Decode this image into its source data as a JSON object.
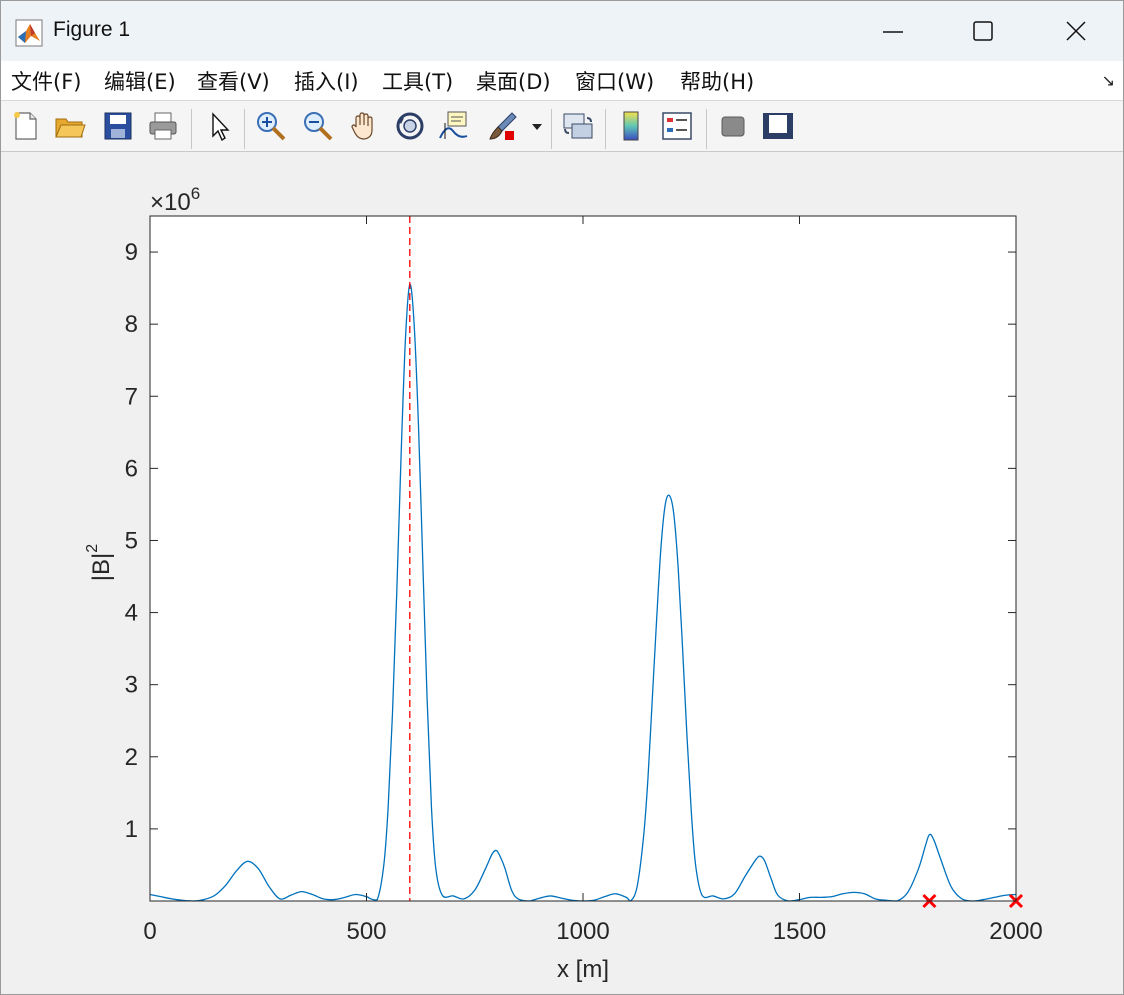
{
  "window": {
    "title": "Figure 1",
    "icon": "matlab-logo-icon",
    "controls": [
      "minimize-icon",
      "maximize-icon",
      "close-icon"
    ]
  },
  "menu": [
    "文件(F)",
    "编辑(E)",
    "查看(V)",
    "插入(I)",
    "工具(T)",
    "桌面(D)",
    "窗口(W)",
    "帮助(H)"
  ],
  "menu_expand_glyph": "↘",
  "toolbar": [
    "new-figure-icon",
    "open-file-icon",
    "save-icon",
    "print-icon",
    "edit-plot-arrow-icon",
    "zoom-in-icon",
    "zoom-out-icon",
    "pan-hand-icon",
    "rotate-3d-icon",
    "data-tips-icon",
    "brush-icon",
    "brush-dropdown-icon",
    "link-plot-icon",
    "colorbar-icon",
    "legend-icon",
    "hide-plot-tools-icon",
    "show-plot-tools-icon"
  ],
  "colors": {
    "line": "#0072BD",
    "marker": "#ff0000",
    "dashed_line": "#ff0000",
    "axes_bg": "#ffffff",
    "figure_bg": "#f0f0f0"
  },
  "chart_data": {
    "type": "line",
    "xlabel": "x [m]",
    "ylabel": "|B|",
    "ylabel_superscript": "2",
    "exponent_label": "×10",
    "exponent_power": "6",
    "xlim": [
      0,
      2000
    ],
    "ylim": [
      0,
      9.5
    ],
    "y_scale": 1000000,
    "xticks": [
      0,
      500,
      1000,
      1500,
      2000
    ],
    "yticks": [
      1,
      2,
      3,
      4,
      5,
      6,
      7,
      8,
      9
    ],
    "grid": false,
    "series": [
      {
        "x": [
          0,
          25,
          50,
          75,
          100,
          125,
          150,
          175,
          200,
          225,
          250,
          275,
          300,
          325,
          350,
          375,
          400,
          425,
          450,
          475,
          500,
          510,
          525,
          540,
          550,
          560,
          570,
          580,
          590,
          600,
          610,
          620,
          630,
          640,
          650,
          660,
          675,
          700,
          725,
          750,
          775,
          790,
          800,
          810,
          820,
          835,
          850,
          875,
          900,
          925,
          950,
          975,
          1000,
          1025,
          1050,
          1075,
          1100,
          1110,
          1125,
          1140,
          1150,
          1160,
          1170,
          1180,
          1190,
          1200,
          1210,
          1220,
          1230,
          1240,
          1250,
          1260,
          1275,
          1300,
          1325,
          1350,
          1375,
          1400,
          1410,
          1420,
          1435,
          1450,
          1475,
          1500,
          1525,
          1550,
          1575,
          1600,
          1625,
          1650,
          1675,
          1700,
          1725,
          1750,
          1775,
          1790,
          1800,
          1810,
          1825,
          1850,
          1875,
          1900,
          1925,
          1950,
          1975,
          2000
        ],
        "y": [
          0.09,
          0.06,
          0.03,
          0.01,
          0.0,
          0.02,
          0.08,
          0.22,
          0.42,
          0.55,
          0.45,
          0.2,
          0.03,
          0.08,
          0.13,
          0.09,
          0.03,
          0.02,
          0.05,
          0.09,
          0.06,
          0.03,
          0.02,
          0.5,
          1.3,
          2.6,
          4.3,
          6.2,
          7.8,
          8.55,
          8.0,
          6.6,
          4.7,
          2.8,
          1.3,
          0.45,
          0.08,
          0.07,
          0.03,
          0.15,
          0.45,
          0.65,
          0.7,
          0.6,
          0.45,
          0.15,
          0.03,
          0.0,
          0.04,
          0.07,
          0.04,
          0.01,
          0.0,
          0.01,
          0.06,
          0.1,
          0.05,
          0.0,
          0.2,
          0.9,
          1.7,
          2.8,
          3.9,
          4.9,
          5.5,
          5.62,
          5.35,
          4.6,
          3.5,
          2.3,
          1.25,
          0.5,
          0.08,
          0.07,
          0.03,
          0.1,
          0.35,
          0.58,
          0.62,
          0.55,
          0.3,
          0.08,
          0.0,
          0.02,
          0.05,
          0.05,
          0.06,
          0.1,
          0.12,
          0.1,
          0.03,
          0.01,
          0.0,
          0.12,
          0.45,
          0.75,
          0.92,
          0.85,
          0.6,
          0.2,
          0.03,
          0.0,
          0.02,
          0.05,
          0.08,
          0.09
        ]
      }
    ],
    "vertical_dashed_line_x": 600,
    "markers": {
      "symbol": "x",
      "points": [
        [
          1800,
          0
        ],
        [
          2000,
          0
        ]
      ]
    }
  }
}
